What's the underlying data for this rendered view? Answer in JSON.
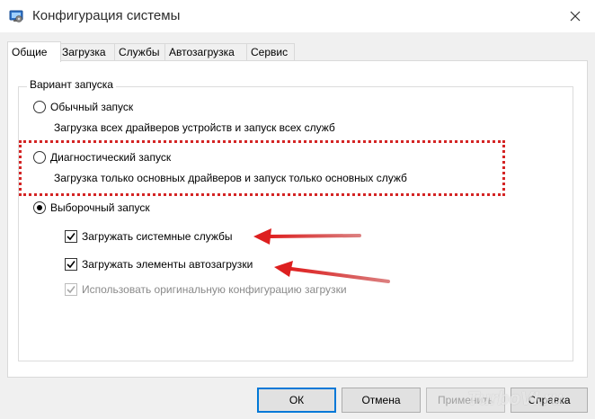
{
  "window": {
    "title": "Конфигурация системы",
    "icon": "msconfig-icon",
    "close_glyph": "✕"
  },
  "tabs": [
    {
      "label": "Общие",
      "active": true
    },
    {
      "label": "Загрузка",
      "active": false
    },
    {
      "label": "Службы",
      "active": false
    },
    {
      "label": "Автозагрузка",
      "active": false
    },
    {
      "label": "Сервис",
      "active": false
    }
  ],
  "startup_selection": {
    "group_label": "Вариант запуска",
    "normal": {
      "label": "Обычный запуск",
      "description": "Загрузка всех драйверов устройств и запуск всех служб",
      "selected": false
    },
    "diagnostic": {
      "label": "Диагностический запуск",
      "description": "Загрузка только основных драйверов и запуск только основных служб",
      "selected": false
    },
    "selective": {
      "label": "Выборочный запуск",
      "selected": true,
      "options": [
        {
          "label": "Загружать системные службы",
          "checked": true,
          "enabled": true
        },
        {
          "label": "Загружать элементы автозагрузки",
          "checked": true,
          "enabled": true
        },
        {
          "label": "Использовать оригинальную конфигурацию загрузки",
          "checked": true,
          "enabled": false
        }
      ]
    }
  },
  "buttons": {
    "ok": "ОК",
    "cancel": "Отмена",
    "apply": "Применить",
    "help": "Справка"
  },
  "watermark": "TurboVI.ru",
  "colors": {
    "highlight": "#d42424",
    "arrow": "#d42424",
    "accent": "#0078d7"
  }
}
